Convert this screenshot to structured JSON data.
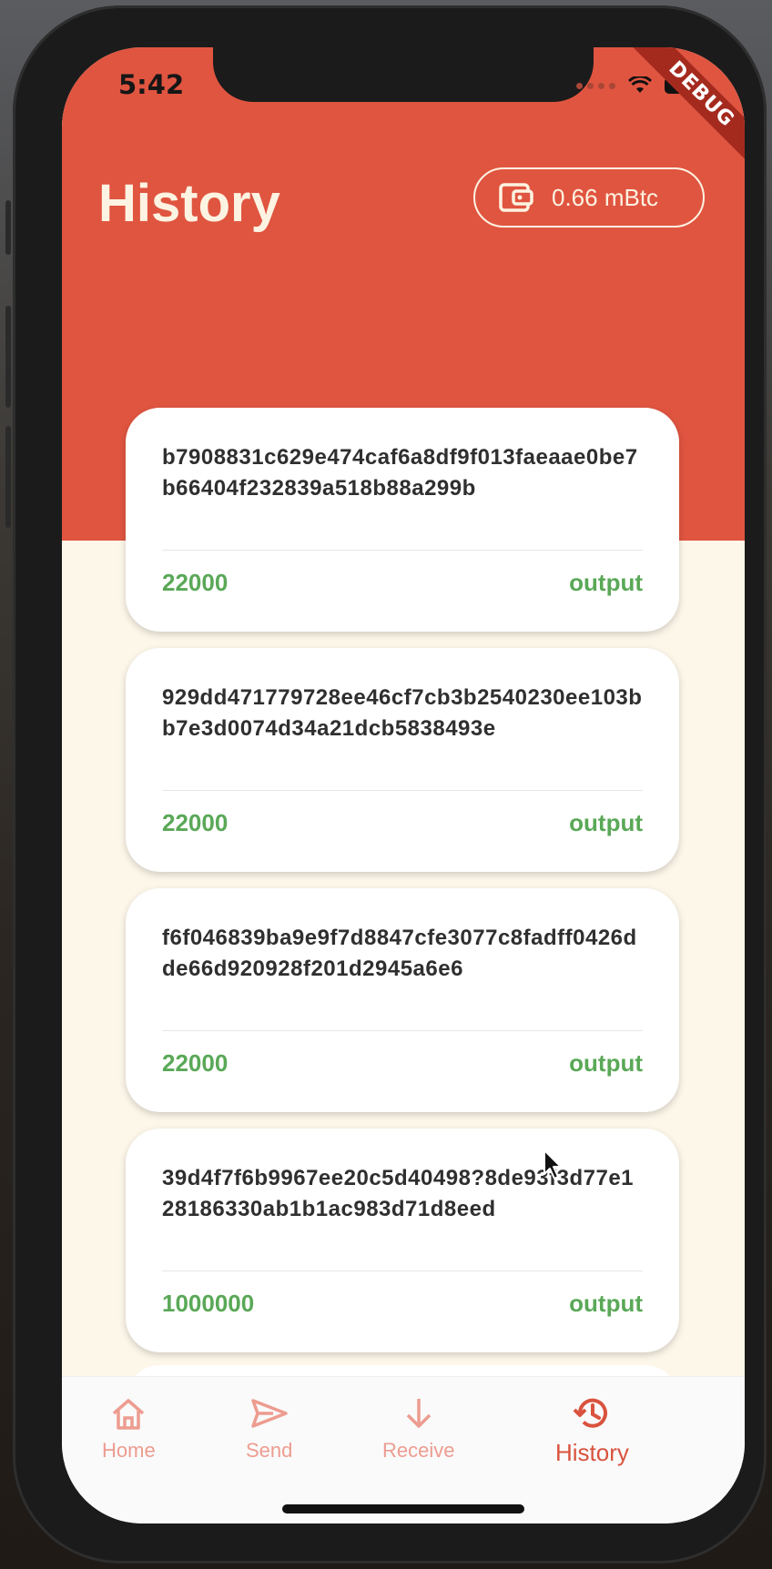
{
  "status_bar": {
    "time": "5:42",
    "debug_label": "DEBUG"
  },
  "header": {
    "title": "History",
    "balance": "0.66 mBtc",
    "balance_icon": "wallet-icon"
  },
  "transactions": [
    {
      "txid": "b7908831c629e474caf6a8df9f013faeaae0be7b66404f232839a518b88a299b",
      "amount": "22000",
      "type": "output"
    },
    {
      "txid": "929dd471779728ee46cf7cb3b2540230ee103bb7e3d0074d34a21dcb5838493e",
      "amount": "22000",
      "type": "output"
    },
    {
      "txid": "f6f046839ba9e9f7d8847cfe3077c8fadff0426dde66d920928f201d2945a6e6",
      "amount": "22000",
      "type": "output"
    },
    {
      "txid": "39d4f7f6b9967ee20c5d40498?8de93f3d77e128186330ab1b1ac983d71d8eed",
      "amount": "1000000",
      "type": "output"
    }
  ],
  "nav": [
    {
      "label": "Home",
      "icon": "home-icon",
      "active": false
    },
    {
      "label": "Send",
      "icon": "send-icon",
      "active": false
    },
    {
      "label": "Receive",
      "icon": "arrow-down-icon",
      "active": false
    },
    {
      "label": "History",
      "icon": "history-icon",
      "active": true
    }
  ],
  "colors": {
    "primary": "#e05540",
    "background": "#fdf7ea",
    "amount_green": "#5aa857",
    "nav_inactive": "#ed9c90",
    "nav_active": "#d9533e"
  }
}
